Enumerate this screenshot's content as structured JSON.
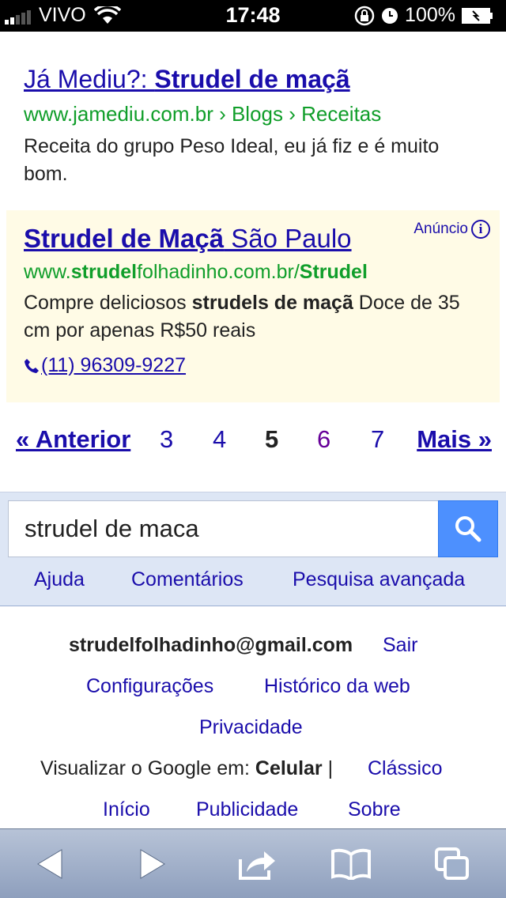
{
  "status_bar": {
    "carrier": "VIVO",
    "time": "17:48",
    "battery": "100%"
  },
  "results": [
    {
      "title_prefix": "Já Mediu?: ",
      "title_bold": "Strudel de maçã",
      "url": "www.jamediu.com.br › Blogs › Receitas",
      "snippet": "Receita do grupo Peso Ideal, eu já fiz e é muito bom."
    }
  ],
  "ad": {
    "title_bold": "Strudel de Maçã",
    "title_rest": " São Paulo",
    "label": "Anúncio",
    "url_prefix": "www.",
    "url_bold1": "strudel",
    "url_mid": "folhadinho.com.br/",
    "url_bold2": "Strudel",
    "snippet_pre": "Compre deliciosos ",
    "snippet_bold": "strudels de maçã",
    "snippet_post": " Doce de 35 cm por apenas R$50 reais",
    "phone": "(11) 96309-9227"
  },
  "pagination": {
    "prev": "« Anterior",
    "pages": [
      "3",
      "4",
      "5",
      "6",
      "7"
    ],
    "current": "5",
    "next": "Mais »"
  },
  "search": {
    "value": "strudel de maca"
  },
  "search_links": {
    "help": "Ajuda",
    "comments": "Comentários",
    "advanced": "Pesquisa avançada"
  },
  "footer": {
    "email": "strudelfolhadinho@gmail.com",
    "signout": "Sair",
    "settings": "Configurações",
    "history": "Histórico da web",
    "privacy": "Privacidade",
    "view_label": "Visualizar o Google em: ",
    "view_current": "Celular",
    "separator": " |",
    "classic": "Clássico",
    "home": "Início",
    "advertising": "Publicidade",
    "about": "Sobre"
  },
  "toolbar": {
    "icons": [
      "back-icon",
      "forward-icon",
      "share-icon",
      "bookmarks-icon",
      "tabs-icon"
    ]
  },
  "colors": {
    "link": "#1a0dab",
    "url_green": "#109e2a",
    "ad_background": "#fffbe6",
    "search_button": "#4d90fe",
    "visited": "#660099"
  }
}
